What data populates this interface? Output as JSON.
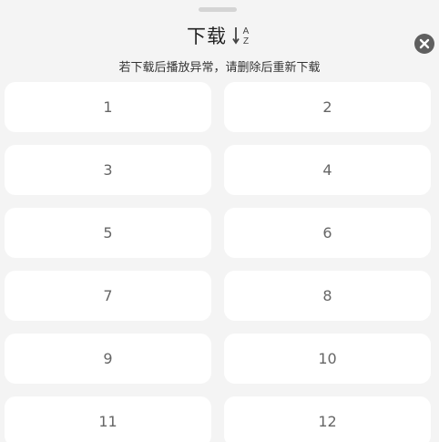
{
  "header": {
    "title": "下载",
    "sort_top": "A",
    "sort_bottom": "Z"
  },
  "subtitle": "若下载后播放异常，请删除后重新下载",
  "colors": {
    "background": "#f4f4f4",
    "card": "#ffffff",
    "close_button": "#5f5f5f"
  },
  "icons": {
    "sort": "sort-az-icon",
    "close": "close-icon"
  },
  "episodes": [
    {
      "label": "1"
    },
    {
      "label": "2"
    },
    {
      "label": "3"
    },
    {
      "label": "4"
    },
    {
      "label": "5"
    },
    {
      "label": "6"
    },
    {
      "label": "7"
    },
    {
      "label": "8"
    },
    {
      "label": "9"
    },
    {
      "label": "10"
    },
    {
      "label": "11"
    },
    {
      "label": "12"
    }
  ]
}
